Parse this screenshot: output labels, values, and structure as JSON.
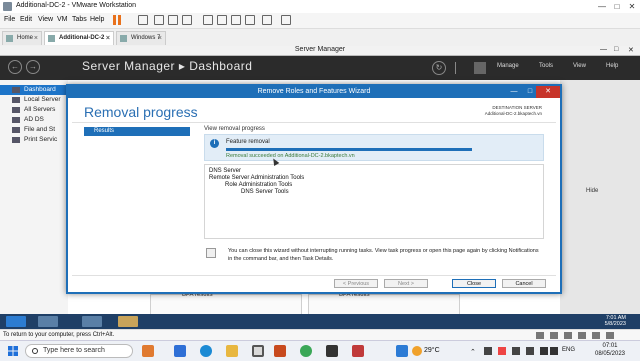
{
  "vmware": {
    "title": "Additional-DC-2 - VMware Workstation",
    "menu": [
      "File",
      "Edit",
      "View",
      "VM",
      "Tabs",
      "Help"
    ],
    "tabs": [
      {
        "label": "Home",
        "active": false
      },
      {
        "label": "Additional-DC-2",
        "active": true
      },
      {
        "label": "Windows 7",
        "active": false
      }
    ],
    "status_text": "To return to your computer, press Ctrl+Alt."
  },
  "server_manager": {
    "window_title": "Server Manager",
    "breadcrumb": "Server Manager  ▸  Dashboard",
    "menus": [
      "Manage",
      "Tools",
      "View",
      "Help"
    ],
    "nav": [
      {
        "label": "Dashboard",
        "selected": true
      },
      {
        "label": "Local Server",
        "selected": false
      },
      {
        "label": "All Servers",
        "selected": false
      },
      {
        "label": "AD DS",
        "selected": false
      },
      {
        "label": "File and St",
        "selected": false
      },
      {
        "label": "Print Servic",
        "selected": false
      }
    ],
    "hide_label": "Hide",
    "bpa_1": "BPA results",
    "bpa_2": "BPA results"
  },
  "wizard": {
    "title": "Remove Roles and Features Wizard",
    "heading": "Removal progress",
    "destination_label": "DESTINATION SERVER",
    "destination_server": "Additional-DC-2.bkaptech.vn",
    "step": "Results",
    "view_progress": "View removal progress",
    "feature_removal": "Feature removal",
    "progress": 1.0,
    "removal_message": "Removal succeeded on Additional-DC-2.bkaptech.vn",
    "features": [
      {
        "label": "DNS Server",
        "indent": 0
      },
      {
        "label": "Remote Server Administration Tools",
        "indent": 0
      },
      {
        "label": "Role Administration Tools",
        "indent": 1
      },
      {
        "label": "DNS Server Tools",
        "indent": 2
      }
    ],
    "note": "You can close this wizard without interrupting running tasks. View task progress or open this page again by clicking Notifications in the command bar, and then Task Details.",
    "buttons": {
      "previous": "< Previous",
      "next": "Next >",
      "close": "Close",
      "cancel": "Cancel"
    }
  },
  "guest_taskbar": {
    "time": "7:01 AM",
    "date": "5/8/2023"
  },
  "host_taskbar": {
    "search_placeholder": "Type here to search",
    "weather": "29°C",
    "lang": "ENG",
    "time": "07:01",
    "date": "08/05/2023"
  },
  "colors": {
    "accent": "#1e6fb8",
    "sm_header": "#2b2b2b",
    "selected_nav": "#1d74c8"
  }
}
